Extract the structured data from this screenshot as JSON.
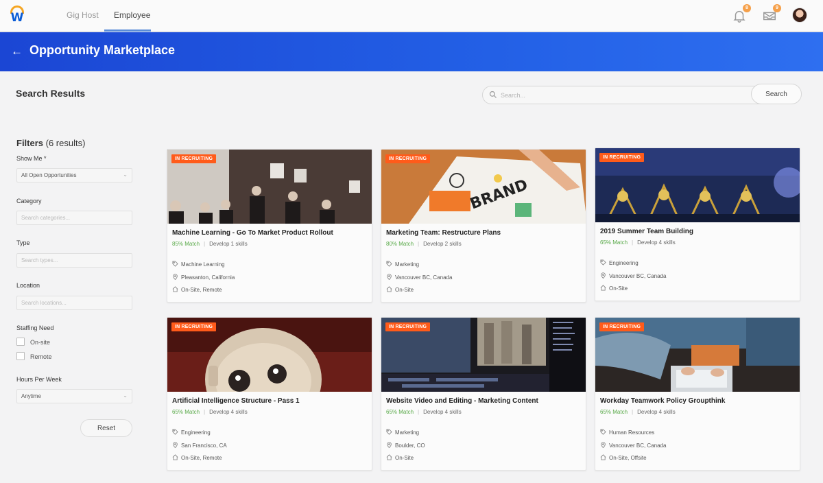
{
  "nav": {
    "tabs": [
      "Gig Host",
      "Employee"
    ],
    "active_tab": "Employee",
    "notifications_count": "8",
    "inbox_count": "9"
  },
  "header": {
    "title": "Opportunity Marketplace"
  },
  "search": {
    "title": "Search Results",
    "placeholder": "Search...",
    "button_label": "Search"
  },
  "filters": {
    "title": "Filters",
    "count_label": "(6 results)",
    "show_me": {
      "label": "Show Me *",
      "value": "All Open Opportunities"
    },
    "category": {
      "label": "Category",
      "placeholder": "Search categories..."
    },
    "type": {
      "label": "Type",
      "placeholder": "Search types..."
    },
    "location": {
      "label": "Location",
      "placeholder": "Search locations..."
    },
    "staffing_need": {
      "label": "Staffing Need",
      "options": [
        "On-site",
        "Remote"
      ]
    },
    "hours_per_week": {
      "label": "Hours Per Week",
      "value": "Anytime"
    },
    "reset_label": "Reset"
  },
  "cards": [
    {
      "tag": "IN RECRUITING",
      "title": "Machine Learning - Go To Market Product Rollout",
      "match": "85% Match",
      "skills": "Develop 1 skills",
      "category": "Machine Learning",
      "location": "Pleasanton, California",
      "site": "On-Site, Remote"
    },
    {
      "tag": "IN RECRUITING",
      "title": "Marketing Team: Restructure Plans",
      "match": "80% Match",
      "skills": "Develop 2 skills",
      "category": "Marketing",
      "location": "Vancouver BC, Canada",
      "site": "On-Site"
    },
    {
      "tag": "IN RECRUITING",
      "title": "2019 Summer Team Building",
      "match": "65% Match",
      "skills": "Develop 4 skills",
      "category": "Engineering",
      "location": "Vancouver BC, Canada",
      "site": "On-Site"
    },
    {
      "tag": "IN RECRUITING",
      "title": "Artificial Intelligence Structure - Pass 1",
      "match": "65% Match",
      "skills": "Develop 4 skills",
      "category": "Engineering",
      "location": "San Francisco, CA",
      "site": "On-Site, Remote"
    },
    {
      "tag": "IN RECRUITING",
      "title": "Website Video and Editing - Marketing Content",
      "match": "65% Match",
      "skills": "Develop 4 skills",
      "category": "Marketing",
      "location": "Boulder, CO",
      "site": "On-Site"
    },
    {
      "tag": "IN RECRUITING",
      "title": "Workday Teamwork Policy Groupthink",
      "match": "65% Match",
      "skills": "Develop 4 skills",
      "category": "Human Resources",
      "location": "Vancouver BC, Canada",
      "site": "On-Site, Offsite"
    }
  ],
  "colors": {
    "brand_blue": "#1b46d4",
    "tag_orange": "#ff5b1a",
    "match_green": "#5aaa4a"
  }
}
